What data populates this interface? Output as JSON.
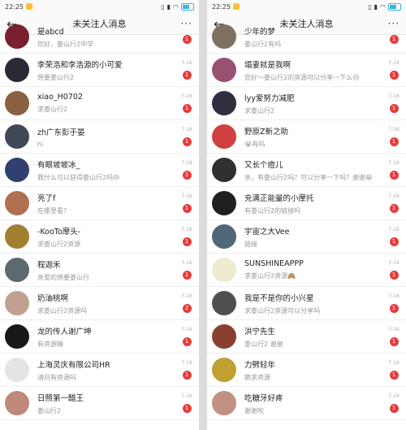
{
  "status": {
    "time": "22:25"
  },
  "header": {
    "title": "未关注人消息",
    "more_label": "···"
  },
  "left_list": [
    {
      "name": "是abcd",
      "msg": "您好，娄山行2中学",
      "time": "",
      "badge": "1",
      "color": "#7a2030"
    },
    {
      "name": "李荣浩和李浩源的小可爱",
      "msg": "想要娄山行2",
      "time": "7-16",
      "badge": "1",
      "color": "#2a2a35"
    },
    {
      "name": "xiao_H0702",
      "msg": "求娄山行2",
      "time": "7-16",
      "badge": "1",
      "color": "#8a6040"
    },
    {
      "name": "zh广东彭于晏",
      "msg": "hi",
      "time": "7-16",
      "badge": "1",
      "color": "#404858"
    },
    {
      "name": "有眼坡坡冰_",
      "msg": "我什么可以获得娄山行2吗😢",
      "time": "7-16",
      "badge": "1",
      "color": "#304070"
    },
    {
      "name": "亮了f",
      "msg": "在哪里看?",
      "time": "7-16",
      "badge": "1",
      "color": "#b07050"
    },
    {
      "name": "-KooTo摩头-",
      "msg": "求娄山行2资源",
      "time": "7-16",
      "badge": "1",
      "color": "#a08030"
    },
    {
      "name": "程迦禾",
      "msg": "亲爱的想要娄山行",
      "time": "7-16",
      "badge": "1",
      "color": "#5a6a70"
    },
    {
      "name": "奶油桃啊",
      "msg": "求娄山行2资源吗",
      "time": "7-16",
      "badge": "2",
      "color": "#c0a090"
    },
    {
      "name": "龙的传人谢广坤",
      "msg": "有资源嘛",
      "time": "7-16",
      "badge": "1",
      "color": "#181818"
    },
    {
      "name": "上海灵庆有限公司HR",
      "msg": "请问有资源吗",
      "time": "7-16",
      "badge": "1",
      "color": "#e4e4e4"
    },
    {
      "name": "日照第一醋王",
      "msg": "娄山行2",
      "time": "7-16",
      "badge": "1",
      "color": "#c08878"
    }
  ],
  "right_list": [
    {
      "name": "少年的梦",
      "msg": "娄山行2有吗",
      "time": "",
      "badge": "1",
      "color": "#807060"
    },
    {
      "name": "塌妻就是我啊",
      "msg": "您好～娄山行2的资源可以分享一下么😢",
      "time": "7-16",
      "badge": "1",
      "color": "#9a5070"
    },
    {
      "name": "lyy爱努力减肥",
      "msg": "求娄山行2",
      "time": "7-16",
      "badge": "1",
      "color": "#303040"
    },
    {
      "name": "野原Z新之助",
      "msg": "😭有吗",
      "time": "7-16",
      "badge": "1",
      "color": "#d04040"
    },
    {
      "name": "又长个痘儿",
      "msg": "亲，有娄山行2吗？可以分享一下吗？谢谢😁",
      "time": "7-16",
      "badge": "1",
      "color": "#303030"
    },
    {
      "name": "充满正能量的小摩托",
      "msg": "有娄山行2的链接吗",
      "time": "7-16",
      "badge": "1",
      "color": "#202020"
    },
    {
      "name": "宇宙之大Vee",
      "msg": "链接",
      "time": "7-16",
      "badge": "1",
      "color": "#506878"
    },
    {
      "name": "SUNSHINEAPPP",
      "msg": "求娄山行2资源🙈",
      "time": "7-16",
      "badge": "1",
      "color": "#f0ead0"
    },
    {
      "name": "我是不是你的小兴星",
      "msg": "求娄山行2资源可以分享吗",
      "time": "7-16",
      "badge": "1",
      "color": "#505050"
    },
    {
      "name": "洪宁先生",
      "msg": "娄山行2 谢谢",
      "time": "7-16",
      "badge": "1",
      "color": "#8a4030"
    },
    {
      "name": "力劈轻年",
      "msg": "跪求资源",
      "time": "7-16",
      "badge": "1",
      "color": "#c0a030"
    },
    {
      "name": "吃糖牙好疼",
      "msg": "谢谢啦",
      "time": "7-16",
      "badge": "1",
      "color": "#c09080"
    }
  ]
}
